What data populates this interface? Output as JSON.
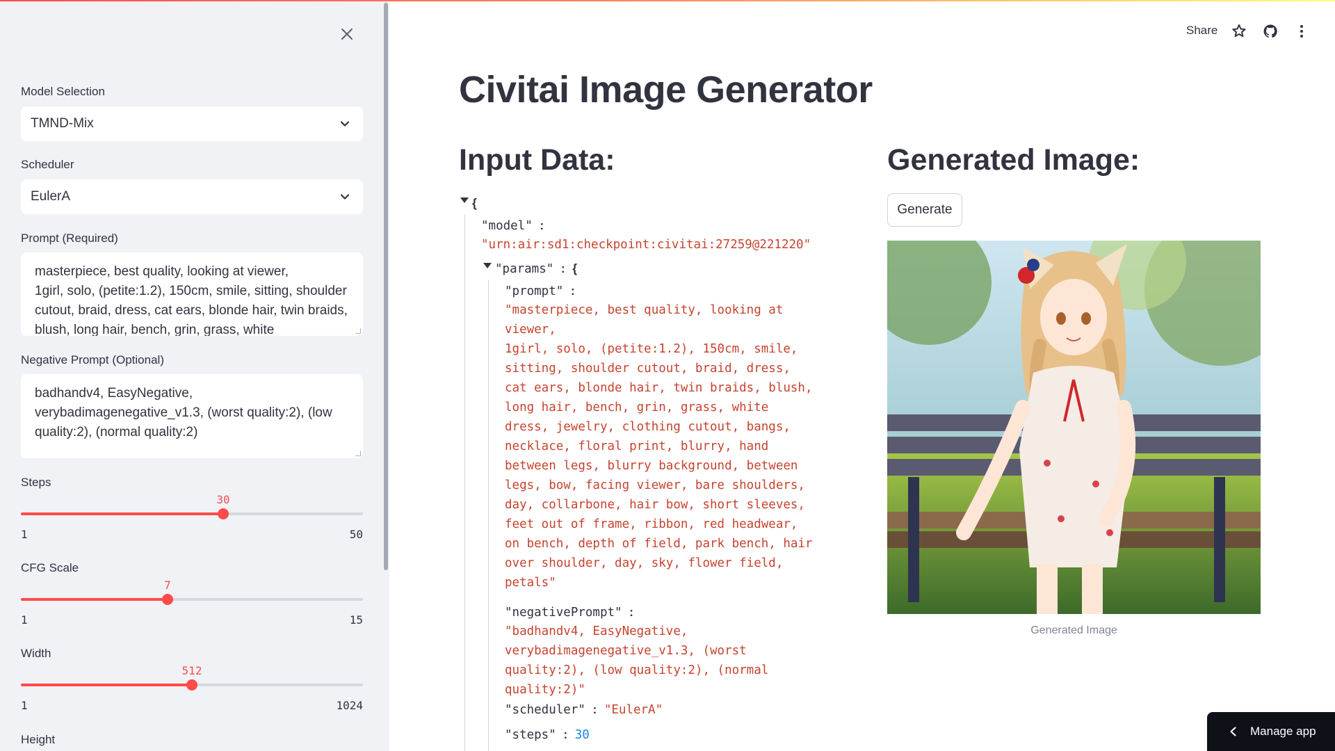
{
  "colors": {
    "accent": "#ff4b4b",
    "sidebar_bg": "#f0f2f6",
    "text": "#31333f",
    "json_string": "#c6432e",
    "json_number": "#1c83e1"
  },
  "toolbar": {
    "share_label": "Share",
    "icons": [
      "star-icon",
      "github-icon",
      "more-vertical-icon"
    ]
  },
  "sidebar": {
    "model_label": "Model Selection",
    "model_value": "TMND-Mix",
    "scheduler_label": "Scheduler",
    "scheduler_value": "EulerA",
    "prompt_label": "Prompt (Required)",
    "prompt_text": "masterpiece, best quality, looking at viewer,\n1girl, solo, (petite:1.2), 150cm, smile, sitting, shoulder cutout, braid, dress, cat ears, blonde hair, twin braids, blush, long hair, bench, grin, grass, white",
    "negative_label": "Negative Prompt (Optional)",
    "negative_text": "badhandv4, EasyNegative, verybadimagenegative_v1.3, (worst quality:2), (low quality:2), (normal quality:2)",
    "steps": {
      "label": "Steps",
      "value": "30",
      "min": "1",
      "max": "50",
      "fraction": 0.592
    },
    "cfg": {
      "label": "CFG Scale",
      "value": "7",
      "min": "1",
      "max": "15",
      "fraction": 0.429
    },
    "width": {
      "label": "Width",
      "value": "512",
      "min": "1",
      "max": "1024",
      "fraction": 0.5
    },
    "height_label": "Height"
  },
  "main": {
    "title": "Civitai Image Generator",
    "input_heading": "Input Data:",
    "output_heading": "Generated Image:",
    "generate_label": "Generate",
    "image_caption": "Generated Image"
  },
  "json": {
    "open_brace": "{",
    "model_key": "\"model\"",
    "model_value": "\"urn:air:sd1:checkpoint:civitai:27259@221220\"",
    "params_key": "\"params\"",
    "prompt_key": "\"prompt\"",
    "prompt_value": "\"masterpiece, best quality, looking at\nviewer,\n1girl, solo, (petite:1.2), 150cm, smile,\nsitting, shoulder cutout, braid, dress,\ncat ears, blonde hair, twin braids, blush,\nlong hair, bench, grin, grass, white\ndress, jewelry, clothing cutout, bangs,\nnecklace, floral print, blurry, hand\nbetween legs, blurry background, between\nlegs, bow, facing viewer, bare shoulders,\nday, collarbone, hair bow, short sleeves,\nfeet out of frame, ribbon, red headwear,\non bench, depth of field, park bench, hair\nover shoulder, day, sky, flower field,\npetals\"",
    "negative_key": "\"negativePrompt\"",
    "negative_value": "\"badhandv4, EasyNegative,\nverybadimagenegative_v1.3, (worst\nquality:2), (low quality:2), (normal\nquality:2)\"",
    "scheduler_key": "\"scheduler\"",
    "scheduler_value": "\"EulerA\"",
    "steps_key": "\"steps\"",
    "steps_value": "30",
    "colon": ":"
  },
  "manage_app_label": "Manage app"
}
